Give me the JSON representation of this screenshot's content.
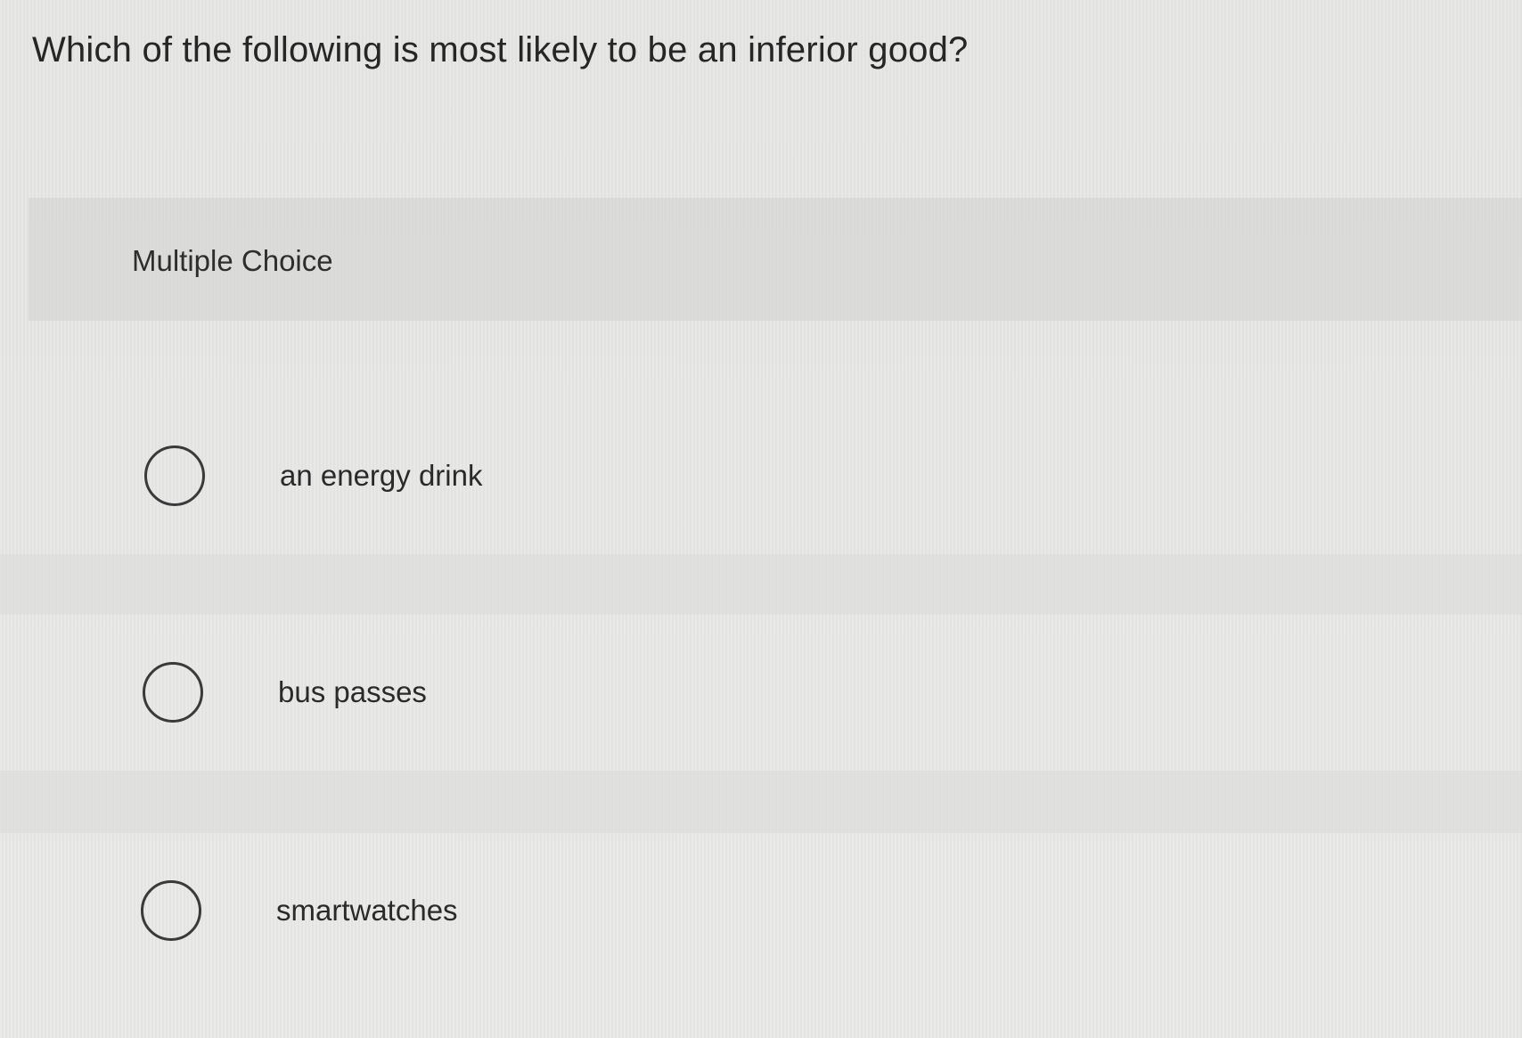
{
  "question": {
    "text": "Which of the following is most likely to be an inferior good?"
  },
  "section": {
    "label": "Multiple Choice"
  },
  "options": [
    {
      "text": "an energy drink",
      "selected": false
    },
    {
      "text": "bus passes",
      "selected": false
    },
    {
      "text": "smartwatches",
      "selected": false
    }
  ]
}
